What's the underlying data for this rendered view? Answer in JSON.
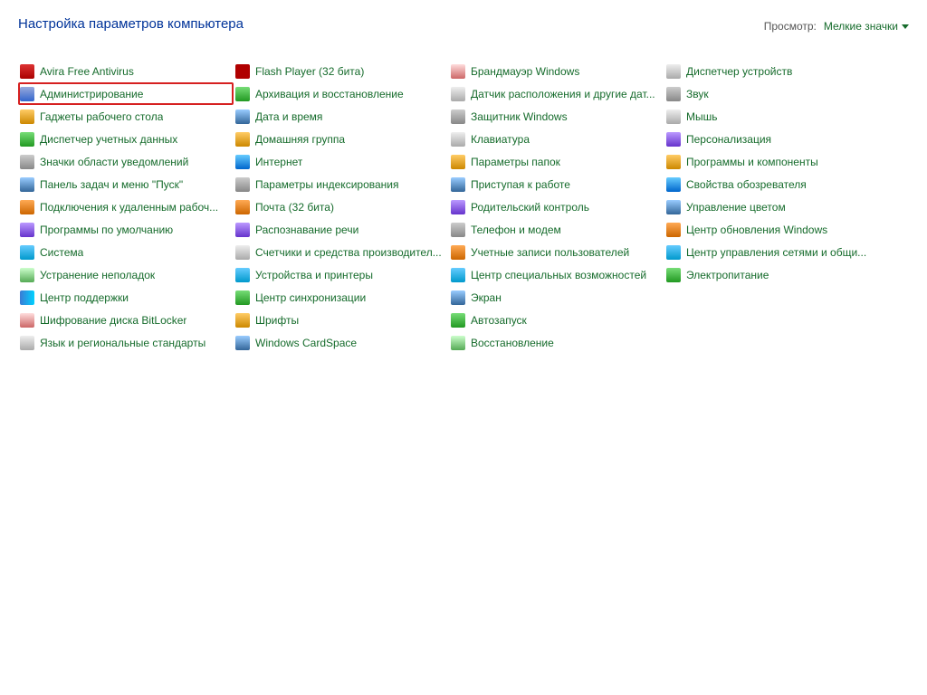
{
  "header": {
    "title": "Настройка параметров компьютера",
    "view_label": "Просмотр:",
    "view_value": "Мелкие значки"
  },
  "columns_per_row": 4,
  "rows_per_column": 13,
  "items": [
    {
      "label": "Avira Free Antivirus",
      "icon": "ic1"
    },
    {
      "label": "Администрирование",
      "icon": "ic2",
      "highlight": true
    },
    {
      "label": "Гаджеты рабочего стола",
      "icon": "ic3"
    },
    {
      "label": "Диспетчер учетных данных",
      "icon": "ic4"
    },
    {
      "label": "Значки области уведомлений",
      "icon": "ic5"
    },
    {
      "label": "Панель задач и меню \"Пуск\"",
      "icon": "ic6"
    },
    {
      "label": "Подключения к удаленным рабоч...",
      "icon": "ic7"
    },
    {
      "label": "Программы по умолчанию",
      "icon": "ic8"
    },
    {
      "label": "Система",
      "icon": "ic9"
    },
    {
      "label": "Устранение неполадок",
      "icon": "ic10"
    },
    {
      "label": "Центр поддержки",
      "icon": "flag"
    },
    {
      "label": "Шифрование диска BitLocker",
      "icon": "ic11"
    },
    {
      "label": "Язык и региональные стандарты",
      "icon": "ic12"
    },
    {
      "label": "Flash Player (32 бита)",
      "icon": "flash"
    },
    {
      "label": "Архивация и восстановление",
      "icon": "ic4"
    },
    {
      "label": "Дата и время",
      "icon": "ic6"
    },
    {
      "label": "Домашняя группа",
      "icon": "ic3"
    },
    {
      "label": "Интернет",
      "icon": "ie"
    },
    {
      "label": "Параметры индексирования",
      "icon": "ic5"
    },
    {
      "label": "Почта (32 бита)",
      "icon": "ic7"
    },
    {
      "label": "Распознавание речи",
      "icon": "ic8"
    },
    {
      "label": "Счетчики и средства производител...",
      "icon": "ic12"
    },
    {
      "label": "Устройства и принтеры",
      "icon": "ic9"
    },
    {
      "label": "Центр синхронизации",
      "icon": "ic4"
    },
    {
      "label": "Шрифты",
      "icon": "ic3"
    },
    {
      "label": "Windows CardSpace",
      "icon": "ic6"
    },
    {
      "label": "Брандмауэр Windows",
      "icon": "ic11"
    },
    {
      "label": "Датчик расположения и другие дат...",
      "icon": "ic12"
    },
    {
      "label": "Защитник Windows",
      "icon": "ic5"
    },
    {
      "label": "Клавиатура",
      "icon": "ic12"
    },
    {
      "label": "Параметры папок",
      "icon": "ic3"
    },
    {
      "label": "Приступая к работе",
      "icon": "ic6"
    },
    {
      "label": "Родительский контроль",
      "icon": "ic8"
    },
    {
      "label": "Телефон и модем",
      "icon": "ic5"
    },
    {
      "label": "Учетные записи пользователей",
      "icon": "ic7"
    },
    {
      "label": "Центр специальных возможностей",
      "icon": "ic9"
    },
    {
      "label": "Экран",
      "icon": "ic6"
    },
    {
      "label": "Автозапуск",
      "icon": "ic4"
    },
    {
      "label": "Восстановление",
      "icon": "ic10"
    },
    {
      "label": "Диспетчер устройств",
      "icon": "ic12"
    },
    {
      "label": "Звук",
      "icon": "ic5"
    },
    {
      "label": "Мышь",
      "icon": "ic12"
    },
    {
      "label": "Персонализация",
      "icon": "ic8"
    },
    {
      "label": "Программы и компоненты",
      "icon": "ic3"
    },
    {
      "label": "Свойства обозревателя",
      "icon": "ie"
    },
    {
      "label": "Управление цветом",
      "icon": "ic6"
    },
    {
      "label": "Центр обновления Windows",
      "icon": "ic7"
    },
    {
      "label": "Центр управления сетями и общи...",
      "icon": "ic9"
    },
    {
      "label": "Электропитание",
      "icon": "ic4"
    }
  ]
}
